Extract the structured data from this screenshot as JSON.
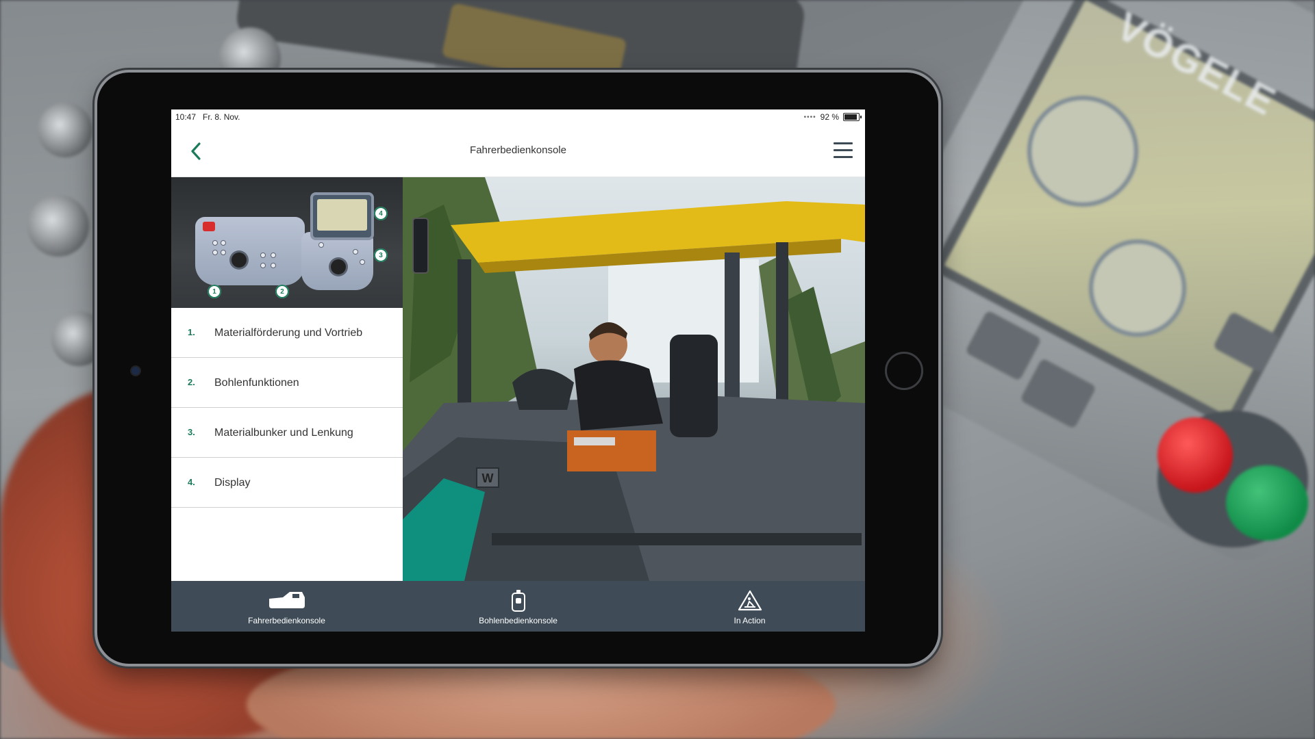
{
  "background": {
    "brand_text": "VÖGELE",
    "brand_color": "#e9ecee"
  },
  "statusbar": {
    "time": "10:47",
    "date": "Fr. 8. Nov.",
    "battery_text": "92 %",
    "battery_level": 0.92
  },
  "navbar": {
    "title": "Fahrerbedienkonsole",
    "back_icon": "chevron-left-icon",
    "menu_icon": "hamburger-menu-icon",
    "accent_color": "#1c7b5b"
  },
  "console_image": {
    "markers": [
      "1",
      "2",
      "3",
      "4"
    ]
  },
  "menu": {
    "items": [
      {
        "number": "1.",
        "label": "Materialförderung und Vortrieb"
      },
      {
        "number": "2.",
        "label": "Bohlenfunktionen"
      },
      {
        "number": "3.",
        "label": "Materialbunker und Lenkung"
      },
      {
        "number": "4.",
        "label": "Display"
      }
    ]
  },
  "tabbar": {
    "background_color": "#3f4c57",
    "tabs": [
      {
        "label": "Fahrerbedienkonsole",
        "icon": "paver-icon"
      },
      {
        "label": "Bohlenbedienkonsole",
        "icon": "screed-console-icon"
      },
      {
        "label": "In Action",
        "icon": "construction-warning-icon"
      }
    ]
  }
}
